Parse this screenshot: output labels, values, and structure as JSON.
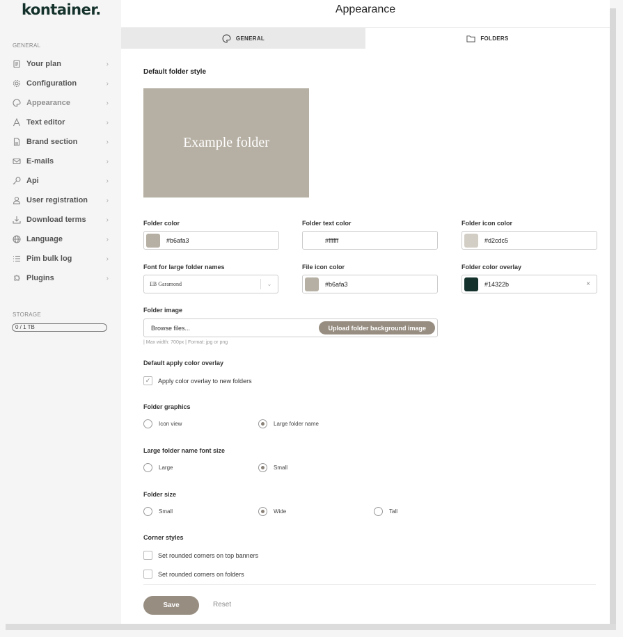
{
  "app": {
    "logo": "kontainer."
  },
  "sidebar": {
    "section_general": "GENERAL",
    "items": [
      {
        "label": "Your plan",
        "icon": "plan-icon"
      },
      {
        "label": "Configuration",
        "icon": "gear-icon"
      },
      {
        "label": "Appearance",
        "icon": "palette-icon",
        "active": true
      },
      {
        "label": "Text editor",
        "icon": "text-icon"
      },
      {
        "label": "Brand section",
        "icon": "document-icon"
      },
      {
        "label": "E-mails",
        "icon": "mail-icon"
      },
      {
        "label": "Api",
        "icon": "key-icon"
      },
      {
        "label": "User registration",
        "icon": "user-icon"
      },
      {
        "label": "Download terms",
        "icon": "download-icon"
      },
      {
        "label": "Language",
        "icon": "globe-icon"
      },
      {
        "label": "Pim bulk log",
        "icon": "list-icon"
      },
      {
        "label": "Plugins",
        "icon": "puzzle-icon"
      }
    ],
    "chevron": "›",
    "section_storage": "STORAGE",
    "storage_usage": "0 / 1 TB"
  },
  "header": {
    "title": "Appearance"
  },
  "tabs": [
    {
      "label": "GENERAL",
      "icon": "palette-icon"
    },
    {
      "label": "FOLDERS",
      "icon": "folder-icon",
      "active": true
    }
  ],
  "folders": {
    "default_style_heading": "Default folder style",
    "preview_text": "Example folder",
    "preview_color": "#b6afa3",
    "folder_color": {
      "label": "Folder color",
      "value": "#b6afa3"
    },
    "folder_text_color": {
      "label": "Folder text color",
      "value": "#ffffff"
    },
    "folder_icon_color": {
      "label": "Folder icon color",
      "value": "#d2cdc5"
    },
    "font_large_names": {
      "label": "Font for large folder names",
      "value": "EB Garamond"
    },
    "file_icon_color": {
      "label": "File icon color",
      "value": "#b6afa3"
    },
    "folder_color_overlay": {
      "label": "Folder color overlay",
      "value": "#14322b",
      "clear": "×"
    },
    "folder_image": {
      "label": "Folder image",
      "placeholder": "Browse files...",
      "upload_button": "Upload folder background image",
      "hint": "| Max width: 700px | Format: jpg or png"
    },
    "default_overlay": {
      "heading": "Default apply color overlay",
      "checkbox_label": "Apply color overlay to new folders",
      "checked": true
    },
    "folder_graphics": {
      "heading": "Folder graphics",
      "options": [
        "Icon view",
        "Large folder name"
      ],
      "selected": "Large folder name"
    },
    "large_font_size": {
      "heading": "Large folder name font size",
      "options": [
        "Large",
        "Small"
      ],
      "selected": "Small"
    },
    "folder_size": {
      "heading": "Folder size",
      "options": [
        "Small",
        "Wide",
        "Tall"
      ],
      "selected": "Wide"
    },
    "corner_styles": {
      "heading": "Corner styles",
      "options": [
        {
          "label": "Set rounded corners on top banners",
          "checked": false
        },
        {
          "label": "Set rounded corners on folders",
          "checked": false
        }
      ]
    }
  },
  "actions": {
    "save": "Save",
    "reset": "Reset"
  },
  "colors": {
    "accent": "#978d81",
    "brand": "#14322b"
  }
}
